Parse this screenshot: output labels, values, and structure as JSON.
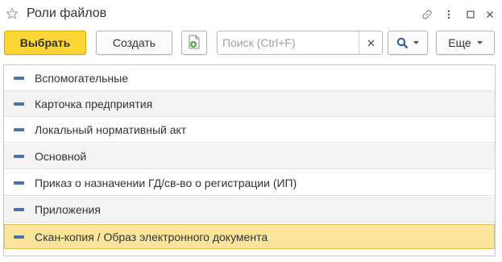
{
  "window": {
    "title": "Роли файлов",
    "favorite_icon": "star-outline-icon",
    "link_icon": "link-icon",
    "more_icon": "vertical-ellipsis-icon",
    "maximize_icon": "maximize-icon",
    "close_icon": "close-icon"
  },
  "toolbar": {
    "select_label": "Выбрать",
    "create_label": "Создать",
    "copy_icon": "document-add-icon",
    "search_placeholder": "Поиск (Ctrl+F)",
    "search_value": "",
    "clear_icon": "close-icon",
    "search_button_icon": "magnifier-icon",
    "more_label": "Еще"
  },
  "list": {
    "items": [
      {
        "label": "Вспомогательные"
      },
      {
        "label": "Карточка предприятия"
      },
      {
        "label": "Локальный нормативный акт"
      },
      {
        "label": "Основной"
      },
      {
        "label": "Приказ о назначении ГД/св-во о регистрации (ИП)"
      },
      {
        "label": "Приложения"
      },
      {
        "label": "Скан-копия / Образ электронного документа"
      }
    ],
    "selected_index": 6
  },
  "colors": {
    "primary_button": "#fcd536",
    "selected_row": "#fbe59c",
    "row_marker": "#4a73a8",
    "alt_row": "#f4f4f4"
  }
}
